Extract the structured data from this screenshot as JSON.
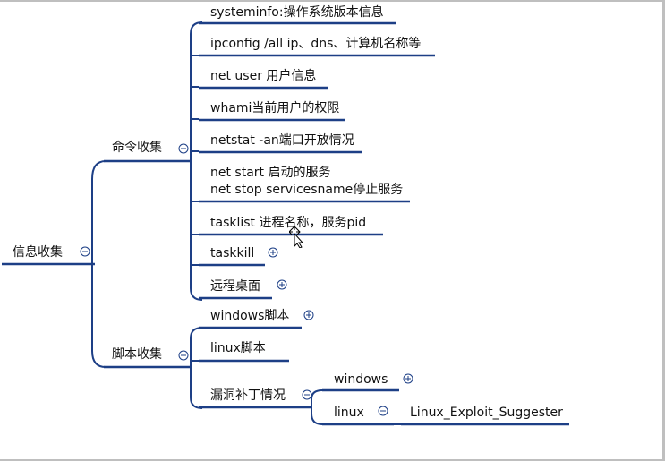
{
  "root": {
    "label": "信息收集"
  },
  "branches": [
    {
      "label": "命令收集",
      "children": [
        {
          "label": "systeminfo:操作系统版本信息"
        },
        {
          "label": "ipconfig /all ip、dns、计算机名称等"
        },
        {
          "label": "net user 用户信息"
        },
        {
          "label": "whami当前用户的权限"
        },
        {
          "label": "netstat -an端口开放情况"
        },
        {
          "label_line1": "net start 启动的服务",
          "label_line2": "net stop servicesname停止服务"
        },
        {
          "label": "tasklist  进程名称，服务pid"
        },
        {
          "label": "taskkill",
          "collapsed": true
        },
        {
          "label": "远程桌面",
          "collapsed": true
        }
      ]
    },
    {
      "label": "脚本收集",
      "children": [
        {
          "label": "windows脚本",
          "collapsed": true
        },
        {
          "label": "linux脚本"
        },
        {
          "label": "漏洞补丁情况",
          "children": [
            {
              "label": "windows",
              "collapsed": true
            },
            {
              "label": "linux",
              "children": [
                {
                  "label": "Linux_Exploit_Suggester"
                }
              ]
            }
          ]
        }
      ]
    }
  ],
  "colors": {
    "line": "#1d3f86",
    "text": "#111111",
    "background": "#ffffff"
  },
  "icons": {
    "expand": "plus-circle-icon",
    "collapse": "minus-circle-icon"
  }
}
